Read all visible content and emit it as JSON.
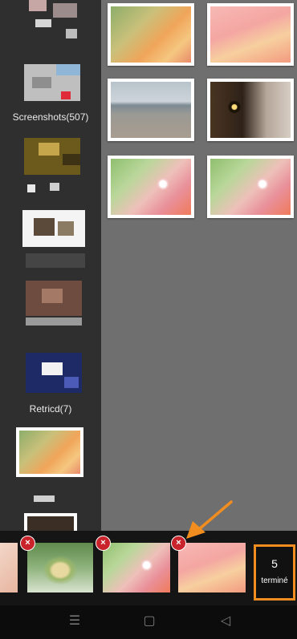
{
  "sidebar": {
    "albums": [
      {
        "label": ""
      },
      {
        "label": "Screenshots(507)"
      },
      {
        "label": ""
      },
      {
        "label": ""
      },
      {
        "label": ""
      },
      {
        "label": "Retricd(7)"
      },
      {
        "label": ""
      }
    ]
  },
  "grid": {
    "photos": [
      {
        "name": "leaf-droplet-orange"
      },
      {
        "name": "leaf-droplet-pink"
      },
      {
        "name": "beach-cliffs"
      },
      {
        "name": "hawk-eye"
      },
      {
        "name": "leaf-droplet-green"
      },
      {
        "name": "leaf-droplet-green-2"
      }
    ]
  },
  "tray": {
    "selected": [
      {
        "name": "selected-partial"
      },
      {
        "name": "selected-tulip-bud"
      },
      {
        "name": "selected-leaf-green"
      },
      {
        "name": "selected-leaf-pink"
      }
    ],
    "remove_symbol": "×",
    "done": {
      "count": "5",
      "label": "terminé"
    }
  },
  "navbar": {
    "menu": "☰",
    "home": "▢",
    "back": "◁"
  },
  "colors": {
    "accent": "#f28d1f",
    "remove_badge": "#c9242b"
  }
}
